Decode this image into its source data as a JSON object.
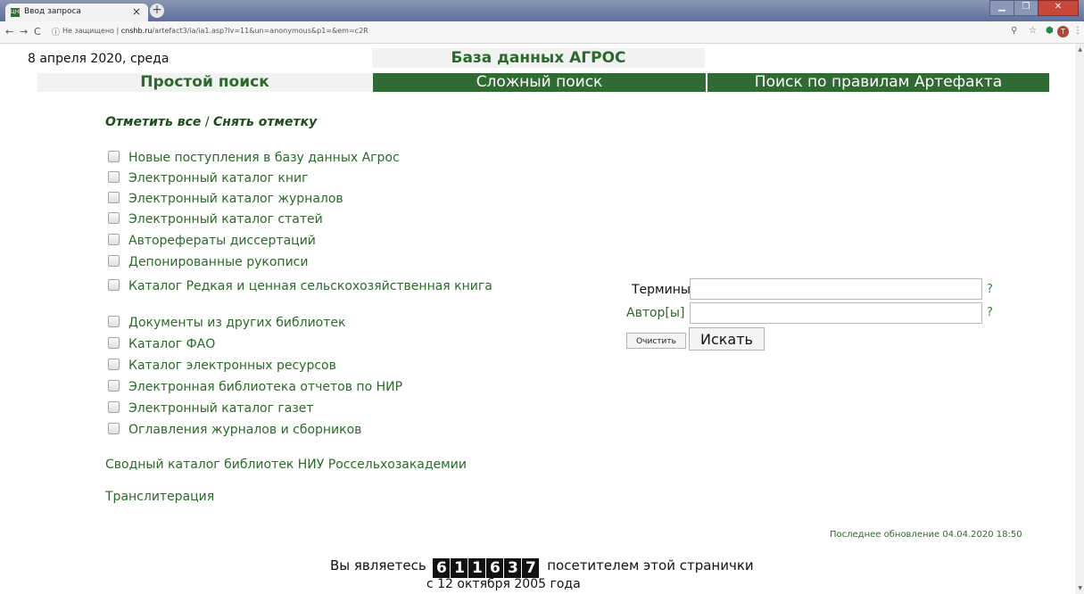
{
  "browser": {
    "tab_title": "Ввод запроса",
    "tab_favicon": "ЦНБ",
    "close_glyph": "×",
    "newtab_glyph": "+",
    "url_security": "Не защищено",
    "url_host": "cnshb.ru",
    "url_path": "/artefact3/ia/ia1.asp?lv=11&un=anonymous&p1=&em=c2R",
    "avatar_letter": "T"
  },
  "header": {
    "date": "8 апреля 2020, среда",
    "db_title": "База данных АГРОС"
  },
  "tabs": {
    "simple": "Простой поиск",
    "complex": "Сложный поиск",
    "artefact": "Поиск по правилам Артефакта"
  },
  "selection": {
    "mark_all": "Отметить все",
    "separator": " / ",
    "unmark": "Снять отметку"
  },
  "databases": [
    "Новые поступления в базу данных Агрос",
    "Электронный каталог книг",
    "Электронный каталог журналов",
    "Электронный каталог статей",
    "Авторефераты диссертаций",
    "Депонированные рукописи",
    "Каталог Редкая и ценная сельскохозяйственная книга",
    "Документы из других библиотек",
    "Каталог ФАО",
    "Каталог электронных ресурсов",
    "Электронная библиотека отчетов по НИР",
    "Электронный каталог газет",
    "Оглавления журналов и сборников"
  ],
  "links": {
    "union_catalog": "Сводный каталог библиотек НИУ Россельхозакадемии",
    "transliteration": "Транслитерация"
  },
  "form": {
    "terms_label": "Термины",
    "authors_label": "Автор[ы]",
    "terms_value": "",
    "authors_value": "",
    "help": "?",
    "clear_button": "Очистить",
    "search_button": "Искать"
  },
  "footer": {
    "last_update": "Последнее обновление 04.04.2020 18:50",
    "visitor_prefix": "Вы являетесь",
    "counter_digits": [
      "6",
      "1",
      "1",
      "6",
      "3",
      "7"
    ],
    "visitor_suffix": "посетителем этой странички",
    "since": "с 12 октября 2005 года"
  },
  "colors": {
    "green_dark": "#2f6b33",
    "green_text": "#2a6a2a",
    "grey_tab": "#f2f2f2"
  }
}
